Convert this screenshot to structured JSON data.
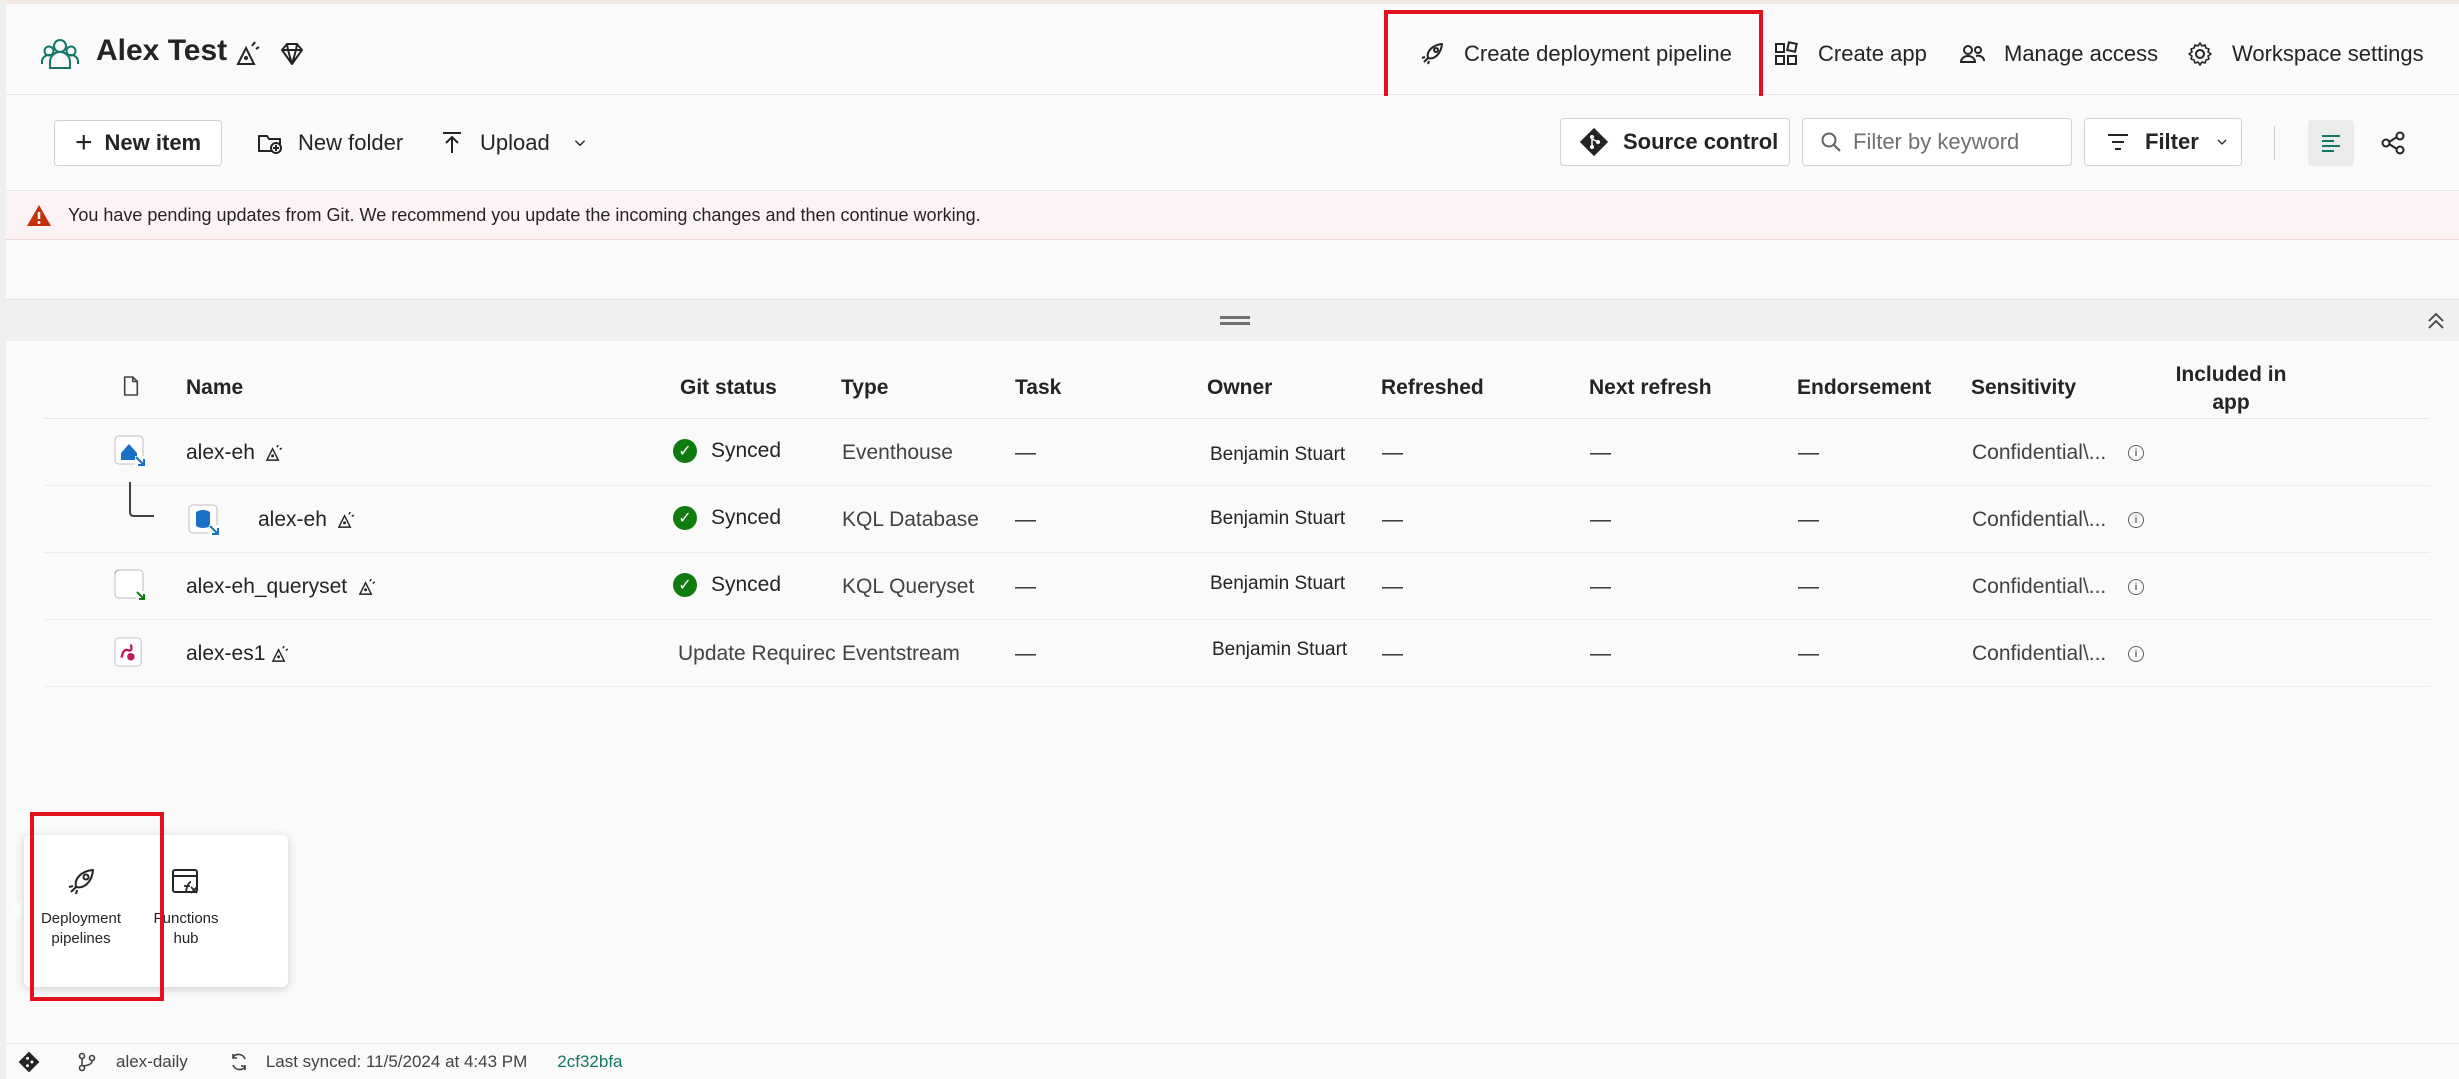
{
  "header": {
    "workspace_name": "Alex Test",
    "actions": {
      "create_pipeline": "Create deployment pipeline",
      "create_app": "Create app",
      "manage_access": "Manage access",
      "workspace_settings": "Workspace settings"
    }
  },
  "toolbar": {
    "new_item": "New item",
    "new_folder": "New folder",
    "upload": "Upload",
    "source_control": "Source control",
    "filter_placeholder": "Filter by keyword",
    "filter": "Filter"
  },
  "banner": {
    "message": "You have pending updates from Git. We recommend you update the incoming changes and then continue working."
  },
  "table": {
    "columns": {
      "name": "Name",
      "git_status": "Git status",
      "type": "Type",
      "task": "Task",
      "owner": "Owner",
      "refreshed": "Refreshed",
      "next_refresh": "Next refresh",
      "endorsement": "Endorsement",
      "sensitivity": "Sensitivity",
      "included_in_app_line1": "Included in",
      "included_in_app_line2": "app"
    },
    "rows": [
      {
        "name": "alex-eh",
        "git_status": "Synced",
        "type": "Eventhouse",
        "task": "—",
        "owner": "Benjamin Stuart",
        "refreshed": "—",
        "next_refresh": "—",
        "endorsement": "—",
        "sensitivity": "Confidential\\..."
      },
      {
        "name": "alex-eh",
        "git_status": "Synced",
        "type": "KQL Database",
        "task": "—",
        "owner": "Benjamin Stuart",
        "refreshed": "—",
        "next_refresh": "—",
        "endorsement": "—",
        "sensitivity": "Confidential\\..."
      },
      {
        "name": "alex-eh_queryset",
        "git_status": "Synced",
        "type": "KQL Queryset",
        "task": "—",
        "owner": "Benjamin Stuart",
        "refreshed": "—",
        "next_refresh": "—",
        "endorsement": "—",
        "sensitivity": "Confidential\\..."
      },
      {
        "name": "alex-es1",
        "git_status": "Update Requirec",
        "type": "Eventstream",
        "task": "—",
        "owner": "Benjamin Stuart",
        "refreshed": "—",
        "next_refresh": "—",
        "endorsement": "—",
        "sensitivity": "Confidential\\..."
      }
    ]
  },
  "popup": {
    "deployment_line1": "Deployment",
    "deployment_line2": "pipelines",
    "functions_line1": "Functions",
    "functions_line2": "hub"
  },
  "footer": {
    "branch": "alex-daily",
    "last_synced": "Last synced: 11/5/2024 at 4:43 PM",
    "commit": "2cf32bfa"
  },
  "colors": {
    "accent": "#117865",
    "highlight_red": "#e3101f",
    "synced_green": "#107c10",
    "warning_red": "#c4310b",
    "banner_bg": "#fdf3f4",
    "commit_link": "#117865"
  }
}
